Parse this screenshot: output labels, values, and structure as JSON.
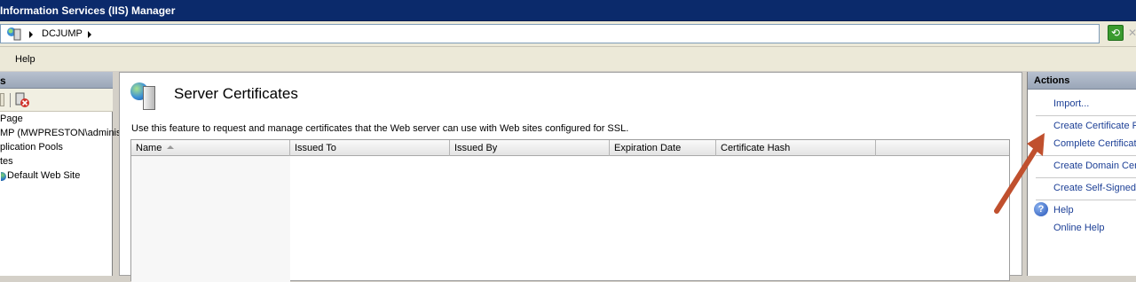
{
  "window": {
    "title": "Information Services (IIS) Manager"
  },
  "address": {
    "crumbs": [
      "DCJUMP"
    ]
  },
  "menu": {
    "items": [
      "Help"
    ]
  },
  "left_panel": {
    "header": "s",
    "tree": [
      "Page",
      "MP (MWPRESTON\\administr",
      "plication Pools",
      "tes",
      "Default Web Site"
    ]
  },
  "main": {
    "title": "Server Certificates",
    "description": "Use this feature to request and manage certificates that the Web server can use with Web sites configured for SSL.",
    "columns": [
      "Name",
      "Issued To",
      "Issued By",
      "Expiration Date",
      "Certificate Hash"
    ],
    "rows": []
  },
  "actions": {
    "header": "Actions",
    "items": [
      "Import...",
      "Create Certificate R",
      "Complete Certificate",
      "Create Domain Cert",
      "Create Self-Signed",
      "Help",
      "Online Help"
    ]
  },
  "colors": {
    "titlebar": "#0b2a6b",
    "link": "#1c3f96",
    "annotation_arrow": "#c0502e"
  }
}
